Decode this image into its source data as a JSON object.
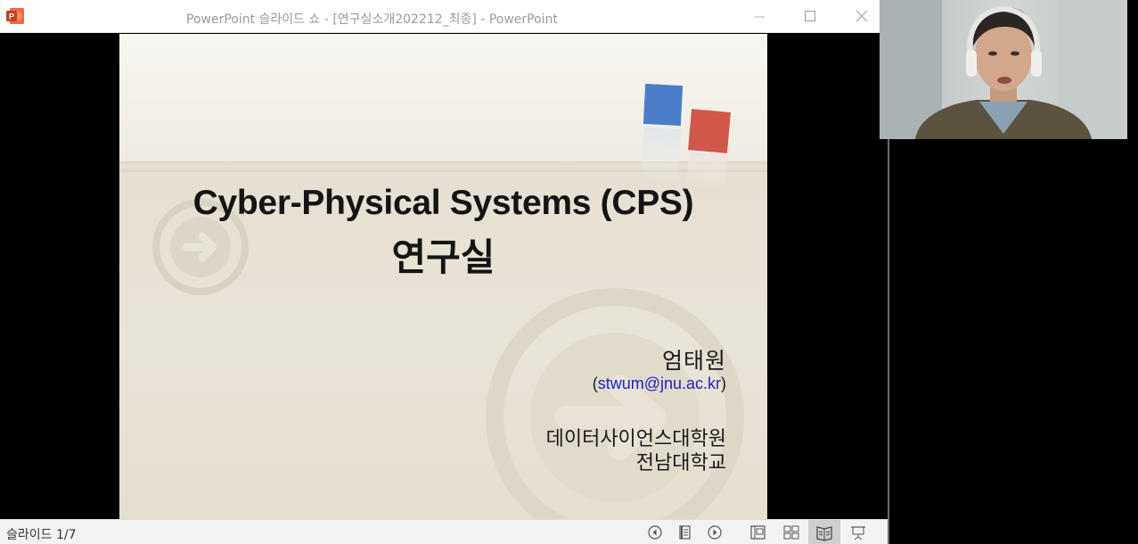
{
  "window": {
    "title": "PowerPoint 슬라이드 쇼  -  [연구실소개202212_최종]  -  PowerPoint",
    "app_icon": "powerpoint-icon",
    "controls": [
      "minimize-icon",
      "maximize-icon",
      "close-icon"
    ]
  },
  "slide": {
    "title_line1": "Cyber-Physical Systems (CPS)",
    "title_line2": "연구실",
    "presenter_name": "엄태원",
    "email_open": "(",
    "email": "stwum@jnu.ac.kr",
    "email_close": ")",
    "school": "데이터사이언스대학원",
    "university": "전남대학교",
    "colors": {
      "accent_blue": "#4a7ec9",
      "accent_red": "#d0574a",
      "link": "#1e22c8"
    }
  },
  "statusbar": {
    "slide_counter": "슬라이드 1/7",
    "icons": [
      "previous-slide-icon",
      "slide-list-icon",
      "next-slide-icon",
      "normal-view-icon",
      "slide-sorter-icon",
      "reading-view-icon",
      "slide-show-icon"
    ]
  },
  "video": {
    "participant": "webcam-feed"
  }
}
